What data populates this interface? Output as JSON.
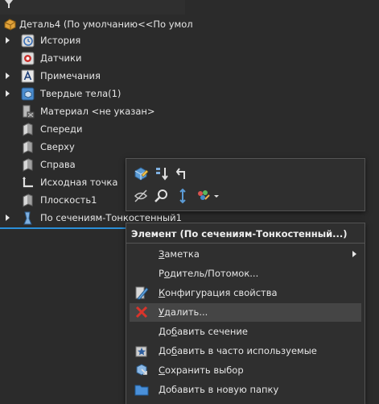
{
  "tree": {
    "root_label": "Деталь4  (По умолчанию<<По умол",
    "items": [
      {
        "label": "История",
        "icon": "history-icon",
        "expandable": true
      },
      {
        "label": "Датчики",
        "icon": "sensor-icon",
        "expandable": false
      },
      {
        "label": "Примечания",
        "icon": "annotation-icon",
        "expandable": true
      },
      {
        "label": "Твердые тела(1)",
        "icon": "solid-bodies-icon",
        "expandable": true
      },
      {
        "label": "Материал <не указан>",
        "icon": "material-icon",
        "expandable": false
      },
      {
        "label": "Спереди",
        "icon": "plane-icon",
        "expandable": false
      },
      {
        "label": "Сверху",
        "icon": "plane-icon",
        "expandable": false
      },
      {
        "label": "Справа",
        "icon": "plane-icon",
        "expandable": false
      },
      {
        "label": "Исходная точка",
        "icon": "origin-icon",
        "expandable": false
      },
      {
        "label": "Плоскость1",
        "icon": "plane-icon",
        "expandable": false
      },
      {
        "label": "По сечениям-Тонкостенный1",
        "icon": "loft-icon",
        "expandable": true,
        "selected": true
      }
    ]
  },
  "context_menu": {
    "header": "Элемент (По сечениям-Тонкостенный...)",
    "items": [
      {
        "pre": "",
        "u": "З",
        "post": "аметка",
        "submenu": true,
        "icon": ""
      },
      {
        "pre": "Р",
        "u": "о",
        "post": "дитель/Потомок...",
        "submenu": false,
        "icon": ""
      },
      {
        "pre": "",
        "u": "К",
        "post": "онфигурация свойства",
        "submenu": false,
        "icon": "config-properties-icon"
      },
      {
        "pre": "",
        "u": "У",
        "post": "далить...",
        "submenu": false,
        "icon": "delete-icon",
        "hover": true
      },
      {
        "pre": "До",
        "u": "б",
        "post": "авить сечение",
        "submenu": false,
        "icon": ""
      },
      {
        "pre": "До",
        "u": "б",
        "post": "авить в часто используемые",
        "submenu": false,
        "icon": "favorite-icon"
      },
      {
        "pre": "",
        "u": "С",
        "post": "охранить выбор",
        "submenu": false,
        "icon": "save-selection-icon"
      },
      {
        "pre": "",
        "u": "Д",
        "post": "обавить в новую папку",
        "submenu": false,
        "icon": "new-folder-icon"
      }
    ]
  },
  "colors": {
    "background": "#2b2b2b",
    "panel": "#2f2f2f",
    "selection_accent": "#2b8fd8",
    "hover": "#454545",
    "text": "#e6e6e6"
  }
}
